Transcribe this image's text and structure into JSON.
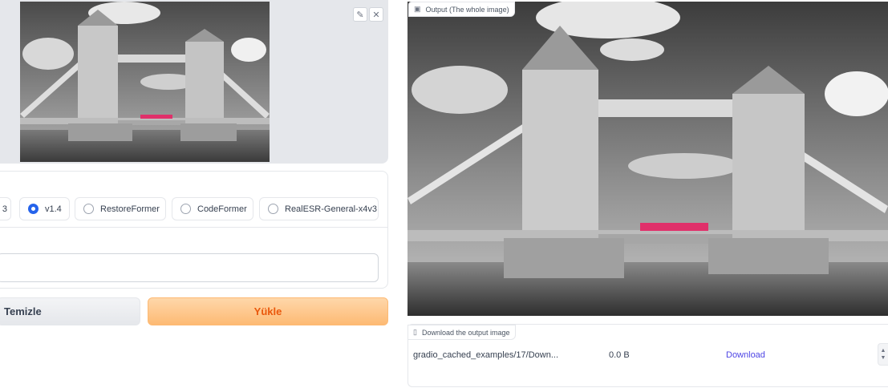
{
  "input_panel": {
    "edit_icon": "pencil-icon",
    "close_icon": "close-icon"
  },
  "model_options": {
    "items": [
      {
        "label": "3",
        "selected": false
      },
      {
        "label": "v1.4",
        "selected": true
      },
      {
        "label": "RestoreFormer",
        "selected": false
      },
      {
        "label": "CodeFormer",
        "selected": false
      },
      {
        "label": "RealESR-General-x4v3",
        "selected": false
      }
    ]
  },
  "text_field": {
    "value": ""
  },
  "buttons": {
    "clear_label": "Temizle",
    "submit_label": "Yükle"
  },
  "output": {
    "label": "Output (The whole image)",
    "icon": "image-icon"
  },
  "download": {
    "label": "Download the output image",
    "icon": "file-icon",
    "file_name": "gradio_cached_examples/17/Down...",
    "file_size": "0.0 B",
    "link_text": "Download"
  },
  "colors": {
    "accent": "#2563eb",
    "submit": "#fdba74",
    "submit_text": "#ea580c",
    "link": "#4f46e5"
  }
}
